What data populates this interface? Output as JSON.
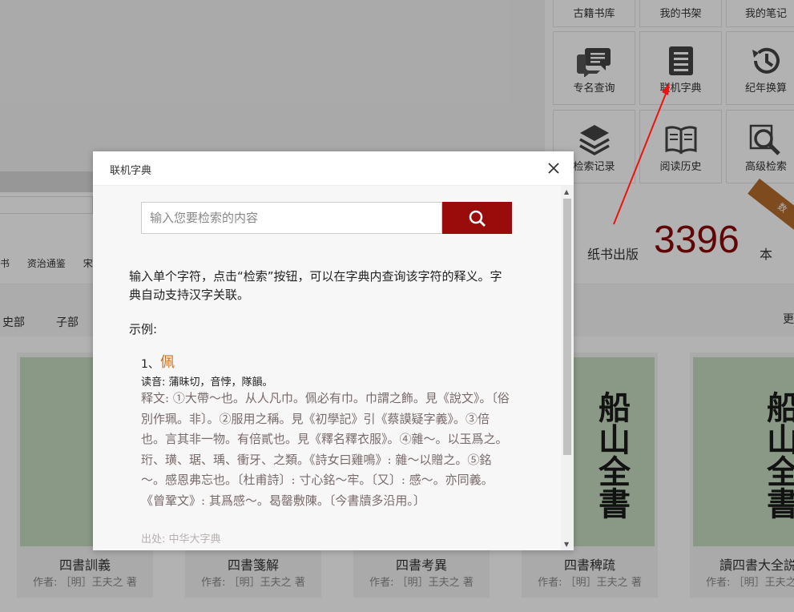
{
  "tiles_top": [
    "古籍书库",
    "我的书架",
    "我的笔记"
  ],
  "tiles_mid": [
    "专名查询",
    "联机字典",
    "纪年换算"
  ],
  "tiles_bottom": [
    "检索记录",
    "阅读历史",
    "高级检索"
  ],
  "nav_links": [
    "书",
    "资治通鉴",
    "宋史"
  ],
  "categories": [
    "史部",
    "子部"
  ],
  "more_label": "更",
  "stats": {
    "label": "纸书出版",
    "count": "3396",
    "unit": "本",
    "corner": "数"
  },
  "books": [
    {
      "title": "四書訓義",
      "author": "作者: ［明］王夫之 著"
    },
    {
      "title": "四書箋解",
      "author": "作者: ［明］王夫之 著"
    },
    {
      "title": "四書考異",
      "author": "作者: ［明］王夫之 著"
    },
    {
      "title": "四書稗疏",
      "author": "作者: ［明］王夫之 著"
    },
    {
      "title": "讀四書大全説",
      "author": "作者: ［明］王夫之 著"
    }
  ],
  "cover_title": "船山全書",
  "modal": {
    "title": "联机字典",
    "search_placeholder": "输入您要检索的内容",
    "intro": "输入单个字符，点击“检索”按钮，可以在字典内查询该字符的释义。字典自动支持汉字关联。",
    "example_label": "示例:",
    "example_num": "1、",
    "example_char": "佩",
    "reading": "读音: 蒲昧切，音悖，隊韻。",
    "definition": "释文: ①大帶～也。从人凡巾。佩必有巾。巾謂之飾。見《說文》。〔俗別作珮。非〕。②服用之稱。見《初學記》引《蔡謨疑字義》。③倍也。言其非一物。有倍貳也。見《釋名釋衣服》。④雜～。以玉爲之。珩、璜、琚、瑀、衝牙、之類。《詩女曰雞鳴》: 雜～以贈之。⑤銘～。感恩弗忘也。〔杜甫詩〕: 寸心銘～牢。〔又〕: 感～。亦同義。《曾鞏文》: 其爲感～。曷罄敷陳。〔今書牘多沿用。〕",
    "source": "出处: 中华大字典"
  }
}
